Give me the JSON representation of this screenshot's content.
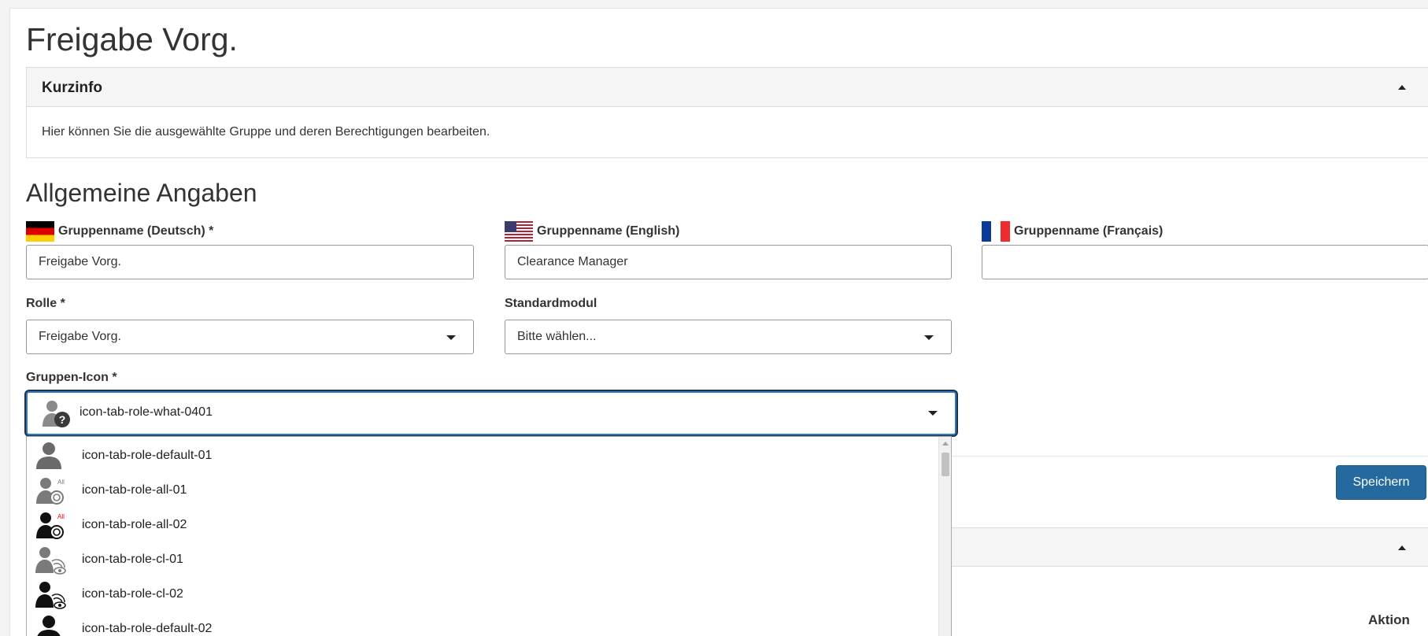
{
  "page": {
    "title": "Freigabe Vorg."
  },
  "kurzinfo": {
    "title": "Kurzinfo",
    "body": "Hier können Sie die ausgewählte Gruppe und deren Berechtigungen bearbeiten."
  },
  "general": {
    "title": "Allgemeine Angaben",
    "name_de": {
      "label": "Gruppenname (Deutsch) *",
      "value": "Freigabe Vorg.",
      "flag": "flag-de-icon"
    },
    "name_en": {
      "label": "Gruppenname (English)",
      "value": "Clearance Manager",
      "flag": "flag-us-icon"
    },
    "name_fr": {
      "label": "Gruppenname (Français)",
      "value": "",
      "flag": "flag-fr-icon"
    },
    "role": {
      "label": "Rolle *",
      "value": "Freigabe Vorg."
    },
    "module": {
      "label": "Standardmodul",
      "value": "Bitte wählen..."
    },
    "group_icon": {
      "label": "Gruppen-Icon *",
      "value": "icon-tab-role-what-0401",
      "options": [
        "icon-tab-role-default-01",
        "icon-tab-role-all-01",
        "icon-tab-role-all-02",
        "icon-tab-role-cl-01",
        "icon-tab-role-cl-02",
        "icon-tab-role-default-02"
      ]
    }
  },
  "actions": {
    "save_label": "Speichern"
  },
  "table": {
    "action_header": "Aktion"
  },
  "colors": {
    "primary": "#246a9e",
    "focus": "#2a78c9",
    "panel_bg": "#f5f5f5"
  }
}
